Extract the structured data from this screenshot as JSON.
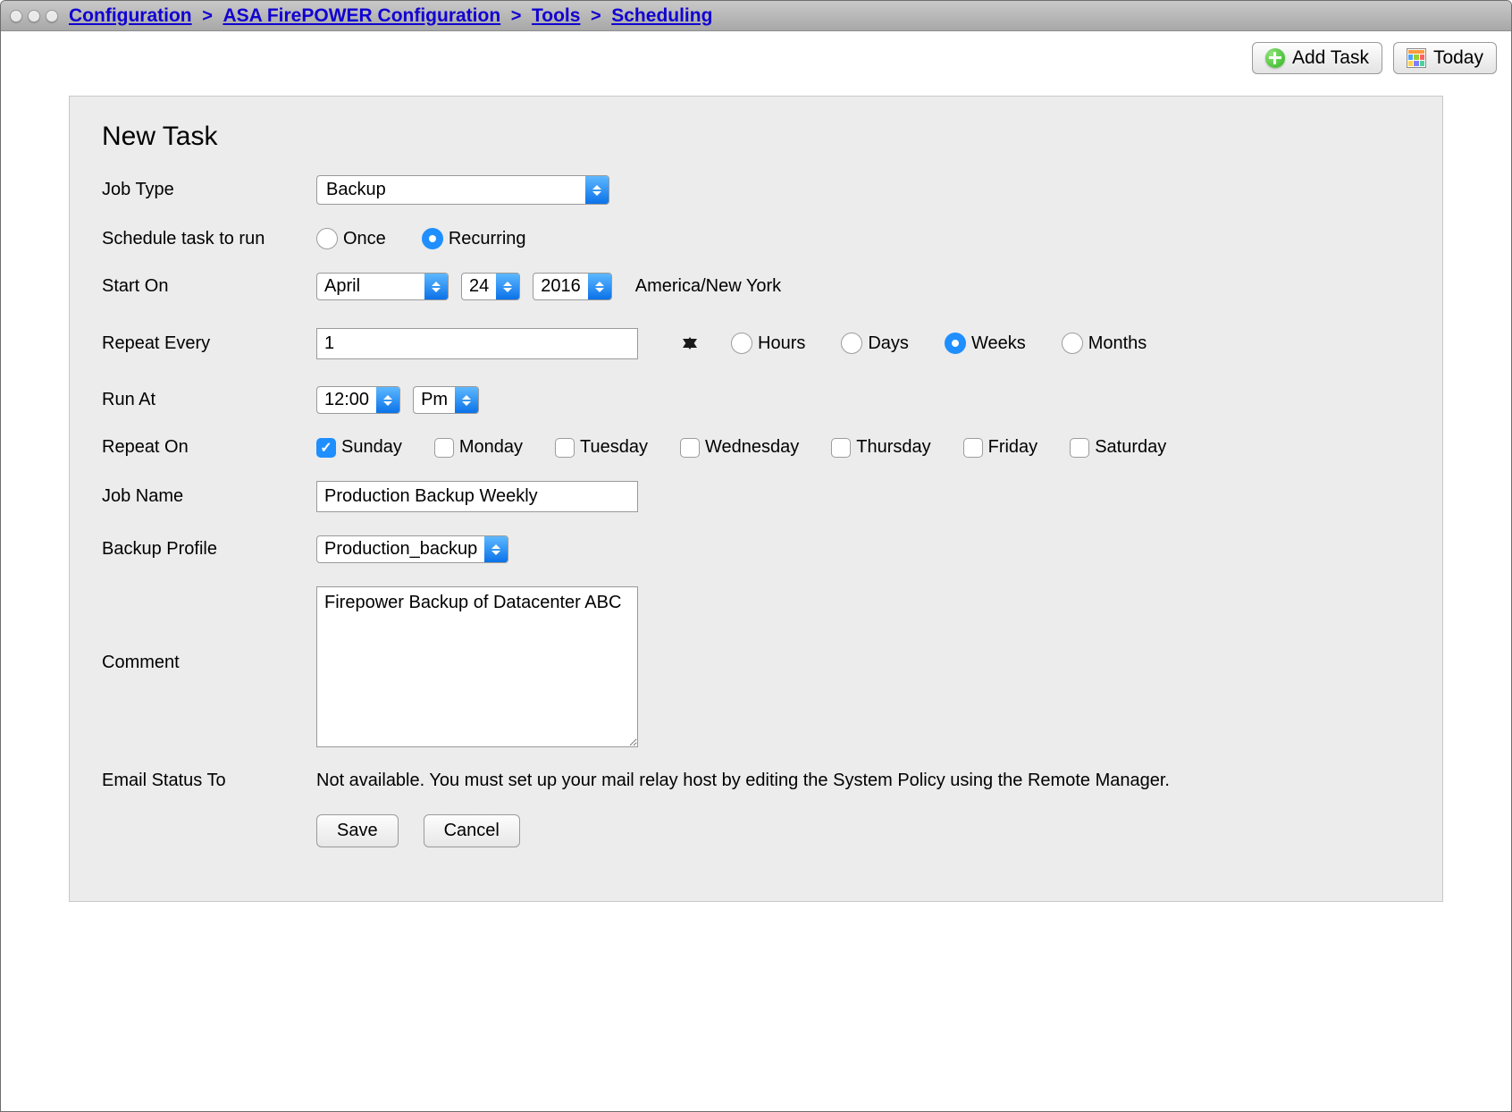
{
  "breadcrumb": {
    "items": [
      "Configuration",
      "ASA FirePOWER Configuration",
      "Tools",
      "Scheduling"
    ]
  },
  "topbar": {
    "add_task_label": "Add Task",
    "today_label": "Today"
  },
  "form": {
    "title": "New Task",
    "labels": {
      "job_type": "Job Type",
      "schedule": "Schedule task to run",
      "start_on": "Start On",
      "repeat_every": "Repeat Every",
      "run_at": "Run At",
      "repeat_on": "Repeat On",
      "job_name": "Job Name",
      "backup_profile": "Backup Profile",
      "comment": "Comment",
      "email_status": "Email Status To"
    },
    "job_type": {
      "value": "Backup"
    },
    "schedule_options": {
      "once": "Once",
      "recurring": "Recurring",
      "selected": "recurring"
    },
    "start_on": {
      "month": "April",
      "day": "24",
      "year": "2016",
      "tz": "America/New York"
    },
    "repeat_every": {
      "value": "1",
      "units": {
        "hours": "Hours",
        "days": "Days",
        "weeks": "Weeks",
        "months": "Months",
        "selected": "weeks"
      }
    },
    "run_at": {
      "time": "12:00",
      "ampm": "Pm"
    },
    "repeat_on": {
      "days": [
        {
          "key": "sunday",
          "label": "Sunday",
          "checked": true
        },
        {
          "key": "monday",
          "label": "Monday",
          "checked": false
        },
        {
          "key": "tuesday",
          "label": "Tuesday",
          "checked": false
        },
        {
          "key": "wednesday",
          "label": "Wednesday",
          "checked": false
        },
        {
          "key": "thursday",
          "label": "Thursday",
          "checked": false
        },
        {
          "key": "friday",
          "label": "Friday",
          "checked": false
        },
        {
          "key": "saturday",
          "label": "Saturday",
          "checked": false
        }
      ]
    },
    "job_name_value": "Production Backup Weekly",
    "backup_profile": {
      "value": "Production_backup"
    },
    "comment_value": "Firepower Backup of Datacenter ABC",
    "email_status_text": "Not available. You must set up your mail relay host by editing the System Policy using the Remote Manager.",
    "buttons": {
      "save": "Save",
      "cancel": "Cancel"
    }
  }
}
